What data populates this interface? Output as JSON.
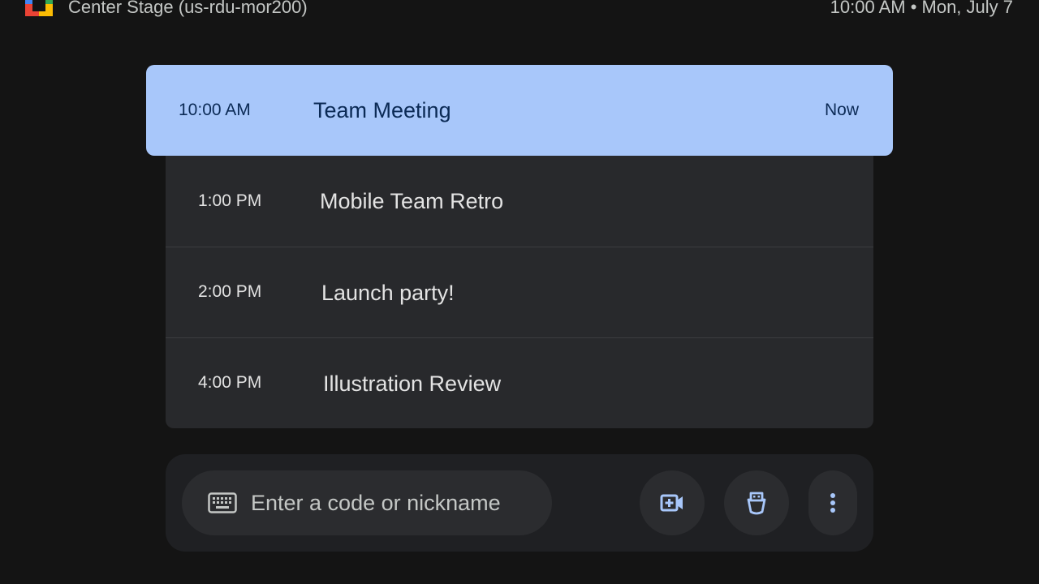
{
  "header": {
    "room_name": "Center Stage (us-rdu-mor200)",
    "datetime": "10:00 AM • Mon, July 7"
  },
  "agenda": {
    "current": {
      "time": "10:00 AM",
      "title": "Team Meeting",
      "status": "Now"
    },
    "upcoming": [
      {
        "time": "1:00 PM",
        "title": "Mobile Team Retro"
      },
      {
        "time": "2:00 PM",
        "title": "Launch party!"
      },
      {
        "time": "4:00 PM",
        "title": "Illustration Review"
      }
    ]
  },
  "bottom_bar": {
    "code_input_placeholder": "Enter a code or nickname",
    "icons": {
      "keyboard": "keyboard-icon",
      "new_meeting": "video-add-icon",
      "cast": "cast-dongle-icon",
      "more": "more-vert-icon"
    }
  },
  "colors": {
    "background": "#141414",
    "current_highlight": "#a8c7fa",
    "current_text": "#0b2a55",
    "list_bg": "#28292c",
    "icon_accent": "#a8c7fa"
  }
}
